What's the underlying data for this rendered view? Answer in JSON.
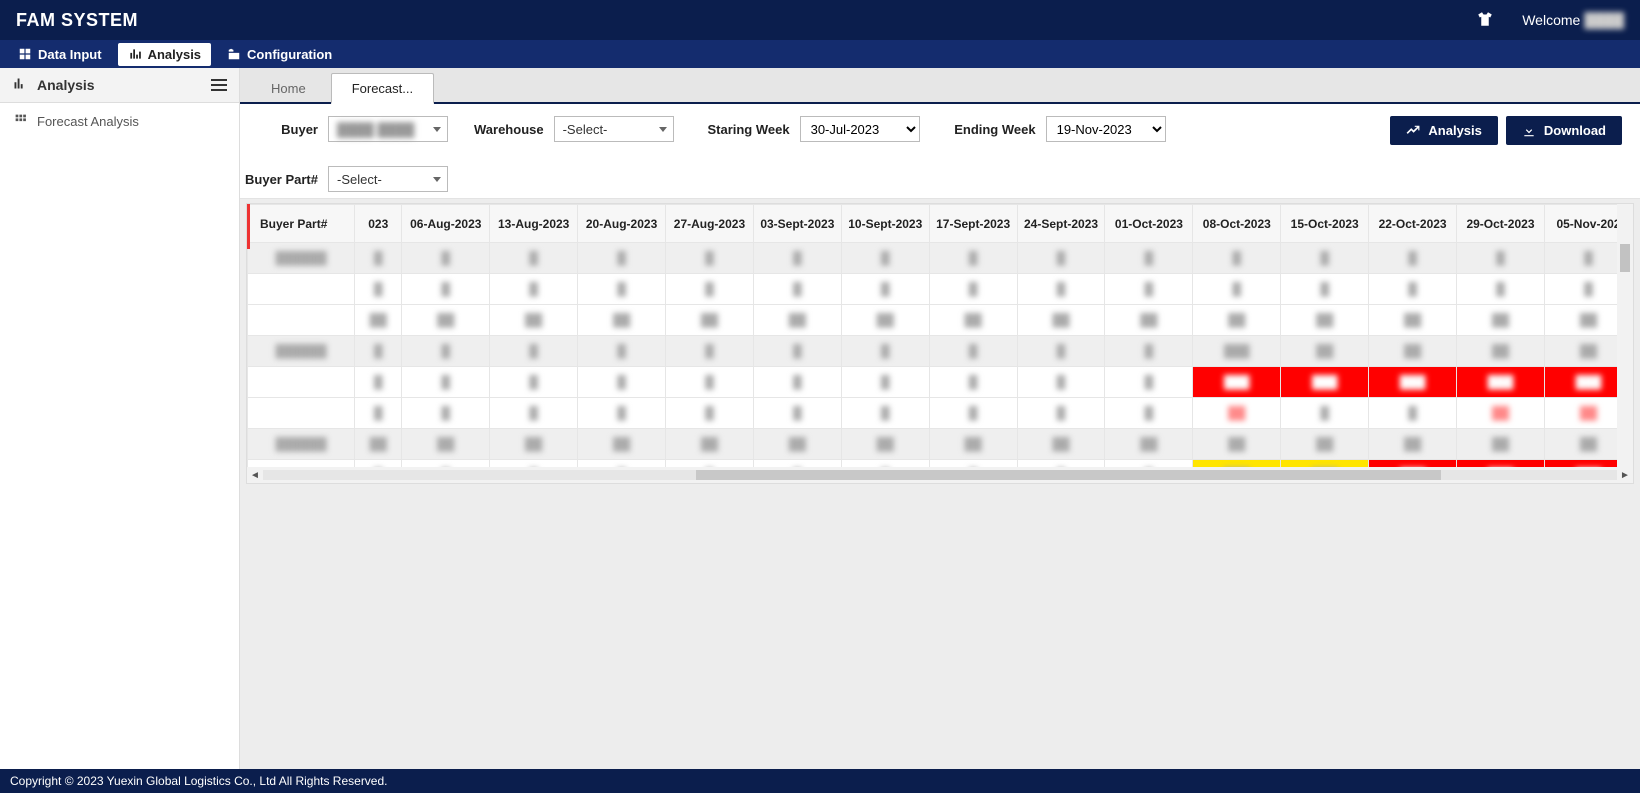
{
  "header": {
    "brand": "FAM SYSTEM",
    "welcome": "Welcome"
  },
  "menu": {
    "data_input": "Data Input",
    "analysis": "Analysis",
    "config": "Configuration"
  },
  "sidebar": {
    "heading": "Analysis",
    "item_forecast": "Forecast Analysis"
  },
  "tabs": {
    "home": "Home",
    "forecast": "Forecast..."
  },
  "filters": {
    "buyer_label": "Buyer",
    "buyer_value": "████ ████",
    "warehouse_label": "Warehouse",
    "warehouse_value": "-Select-",
    "start_label": "Staring Week",
    "start_value": "30-Jul-2023",
    "end_label": "Ending Week",
    "end_value": "19-Nov-2023",
    "buyer_part_label": "Buyer Part#",
    "buyer_part_value": "-Select-"
  },
  "buttons": {
    "analysis": "Analysis",
    "download": "Download"
  },
  "grid": {
    "headers": [
      "Buyer Part#",
      "023",
      "06-Aug-2023",
      "13-Aug-2023",
      "20-Aug-2023",
      "27-Aug-2023",
      "03-Sept-2023",
      "10-Sept-2023",
      "17-Sept-2023",
      "24-Sept-2023",
      "01-Oct-2023",
      "08-Oct-2023",
      "15-Oct-2023",
      "22-Oct-2023",
      "29-Oct-2023",
      "05-Nov-202"
    ],
    "rows": [
      {
        "part": "██████",
        "shade": true,
        "cells": [
          {
            "v": "█"
          },
          {
            "v": "█"
          },
          {
            "v": "█"
          },
          {
            "v": "█"
          },
          {
            "v": "█"
          },
          {
            "v": "█"
          },
          {
            "v": "█"
          },
          {
            "v": "█"
          },
          {
            "v": "█"
          },
          {
            "v": "█"
          },
          {
            "v": "█"
          },
          {
            "v": "█"
          },
          {
            "v": "█"
          },
          {
            "v": "█"
          },
          {
            "v": "█"
          }
        ]
      },
      {
        "part": "",
        "shade": false,
        "cells": [
          {
            "v": "█"
          },
          {
            "v": "█"
          },
          {
            "v": "█"
          },
          {
            "v": "█"
          },
          {
            "v": "█"
          },
          {
            "v": "█"
          },
          {
            "v": "█"
          },
          {
            "v": "█"
          },
          {
            "v": "█"
          },
          {
            "v": "█"
          },
          {
            "v": "█"
          },
          {
            "v": "█"
          },
          {
            "v": "█"
          },
          {
            "v": "█"
          },
          {
            "v": "█"
          }
        ]
      },
      {
        "part": "",
        "shade": false,
        "cells": [
          {
            "v": "██"
          },
          {
            "v": "██"
          },
          {
            "v": "██"
          },
          {
            "v": "██"
          },
          {
            "v": "██"
          },
          {
            "v": "██"
          },
          {
            "v": "██"
          },
          {
            "v": "██"
          },
          {
            "v": "██"
          },
          {
            "v": "██"
          },
          {
            "v": "██"
          },
          {
            "v": "██"
          },
          {
            "v": "██"
          },
          {
            "v": "██"
          },
          {
            "v": "██"
          }
        ]
      },
      {
        "part": "██████",
        "shade": true,
        "cells": [
          {
            "v": "█"
          },
          {
            "v": "█"
          },
          {
            "v": "█"
          },
          {
            "v": "█"
          },
          {
            "v": "█"
          },
          {
            "v": "█"
          },
          {
            "v": "█"
          },
          {
            "v": "█"
          },
          {
            "v": "█"
          },
          {
            "v": "█"
          },
          {
            "v": "███"
          },
          {
            "v": "██"
          },
          {
            "v": "██"
          },
          {
            "v": "██"
          },
          {
            "v": "██"
          }
        ]
      },
      {
        "part": "",
        "shade": false,
        "cells": [
          {
            "v": "█"
          },
          {
            "v": "█"
          },
          {
            "v": "█"
          },
          {
            "v": "█"
          },
          {
            "v": "█"
          },
          {
            "v": "█"
          },
          {
            "v": "█"
          },
          {
            "v": "█"
          },
          {
            "v": "█"
          },
          {
            "v": "█"
          },
          {
            "v": "███",
            "c": "cell-red"
          },
          {
            "v": "███",
            "c": "cell-red"
          },
          {
            "v": "███",
            "c": "cell-red"
          },
          {
            "v": "███",
            "c": "cell-red"
          },
          {
            "v": "███",
            "c": "cell-red"
          }
        ]
      },
      {
        "part": "",
        "shade": false,
        "cells": [
          {
            "v": "█"
          },
          {
            "v": "█"
          },
          {
            "v": "█"
          },
          {
            "v": "█"
          },
          {
            "v": "█"
          },
          {
            "v": "█"
          },
          {
            "v": "█"
          },
          {
            "v": "█"
          },
          {
            "v": "█"
          },
          {
            "v": "█"
          },
          {
            "v": "██",
            "c": "cell-pink"
          },
          {
            "v": "█"
          },
          {
            "v": "█"
          },
          {
            "v": "██",
            "c": "cell-pink"
          },
          {
            "v": "██",
            "c": "cell-pink"
          }
        ]
      },
      {
        "part": "██████",
        "shade": true,
        "cells": [
          {
            "v": "██"
          },
          {
            "v": "██"
          },
          {
            "v": "██"
          },
          {
            "v": "██"
          },
          {
            "v": "██"
          },
          {
            "v": "██"
          },
          {
            "v": "██"
          },
          {
            "v": "██"
          },
          {
            "v": "██"
          },
          {
            "v": "██"
          },
          {
            "v": "██"
          },
          {
            "v": "██"
          },
          {
            "v": "██"
          },
          {
            "v": "██"
          },
          {
            "v": "██"
          }
        ]
      },
      {
        "part": "",
        "shade": false,
        "cells": [
          {
            "v": "█"
          },
          {
            "v": "█"
          },
          {
            "v": "█"
          },
          {
            "v": "█"
          },
          {
            "v": "█"
          },
          {
            "v": "█"
          },
          {
            "v": "█"
          },
          {
            "v": "█"
          },
          {
            "v": "█"
          },
          {
            "v": "█"
          },
          {
            "v": "███",
            "c": "cell-yellow"
          },
          {
            "v": "███",
            "c": "cell-yellow"
          },
          {
            "v": "███",
            "c": "cell-red"
          },
          {
            "v": "███",
            "c": "cell-red"
          },
          {
            "v": "███",
            "c": "cell-red"
          }
        ]
      },
      {
        "part": "",
        "shade": false,
        "cells": [
          {
            "v": "█"
          },
          {
            "v": "█"
          },
          {
            "v": "█"
          },
          {
            "v": "█"
          },
          {
            "v": "█"
          },
          {
            "v": "█"
          },
          {
            "v": "█"
          },
          {
            "v": "█"
          },
          {
            "v": "█"
          },
          {
            "v": "█"
          },
          {
            "v": "█"
          },
          {
            "v": "█"
          },
          {
            "v": "██",
            "c": "cell-pink"
          },
          {
            "v": "█"
          },
          {
            "v": "██",
            "c": "cell-pink"
          }
        ]
      },
      {
        "part": "███████",
        "shade": true,
        "cells": [
          {
            "v": "██"
          },
          {
            "v": "██"
          },
          {
            "v": "██"
          },
          {
            "v": "██"
          },
          {
            "v": "██"
          },
          {
            "v": "██"
          },
          {
            "v": "██"
          },
          {
            "v": "██"
          },
          {
            "v": "██"
          },
          {
            "v": "██"
          },
          {
            "v": "██"
          },
          {
            "v": "██"
          },
          {
            "v": "██"
          },
          {
            "v": "██"
          },
          {
            "v": "██"
          }
        ]
      },
      {
        "part": "",
        "shade": false,
        "cells": [
          {
            "v": "██"
          },
          {
            "v": "██"
          },
          {
            "v": "██"
          },
          {
            "v": "██"
          },
          {
            "v": "██"
          },
          {
            "v": "██"
          },
          {
            "v": "██"
          },
          {
            "v": "██"
          },
          {
            "v": "██"
          },
          {
            "v": "██"
          },
          {
            "v": "██"
          },
          {
            "v": "██"
          },
          {
            "v": "██"
          },
          {
            "v": "██"
          },
          {
            "v": "██"
          }
        ]
      },
      {
        "part": "",
        "shade": false,
        "cells": [
          {
            "v": "██"
          },
          {
            "v": "██"
          },
          {
            "v": "██"
          },
          {
            "v": "███"
          },
          {
            "v": "███"
          },
          {
            "v": "██"
          },
          {
            "v": "██"
          },
          {
            "v": "███"
          },
          {
            "v": "███"
          },
          {
            "v": "██"
          },
          {
            "v": "██"
          },
          {
            "v": "██"
          },
          {
            "v": "██"
          },
          {
            "v": "██"
          },
          {
            "v": "██"
          }
        ]
      },
      {
        "part": "██████",
        "shade": true,
        "cells": [
          {
            "v": "██"
          },
          {
            "v": "██"
          },
          {
            "v": "██"
          },
          {
            "v": "██"
          },
          {
            "v": "██"
          },
          {
            "v": "██"
          },
          {
            "v": "██"
          },
          {
            "v": "██"
          },
          {
            "v": "██"
          },
          {
            "v": "██"
          },
          {
            "v": "██"
          },
          {
            "v": "██"
          },
          {
            "v": "██"
          },
          {
            "v": "██"
          },
          {
            "v": "██"
          }
        ]
      }
    ]
  },
  "footer": {
    "copyright": "Copyright © 2023  Yuexin Global Logistics Co., Ltd  All Rights Reserved."
  }
}
